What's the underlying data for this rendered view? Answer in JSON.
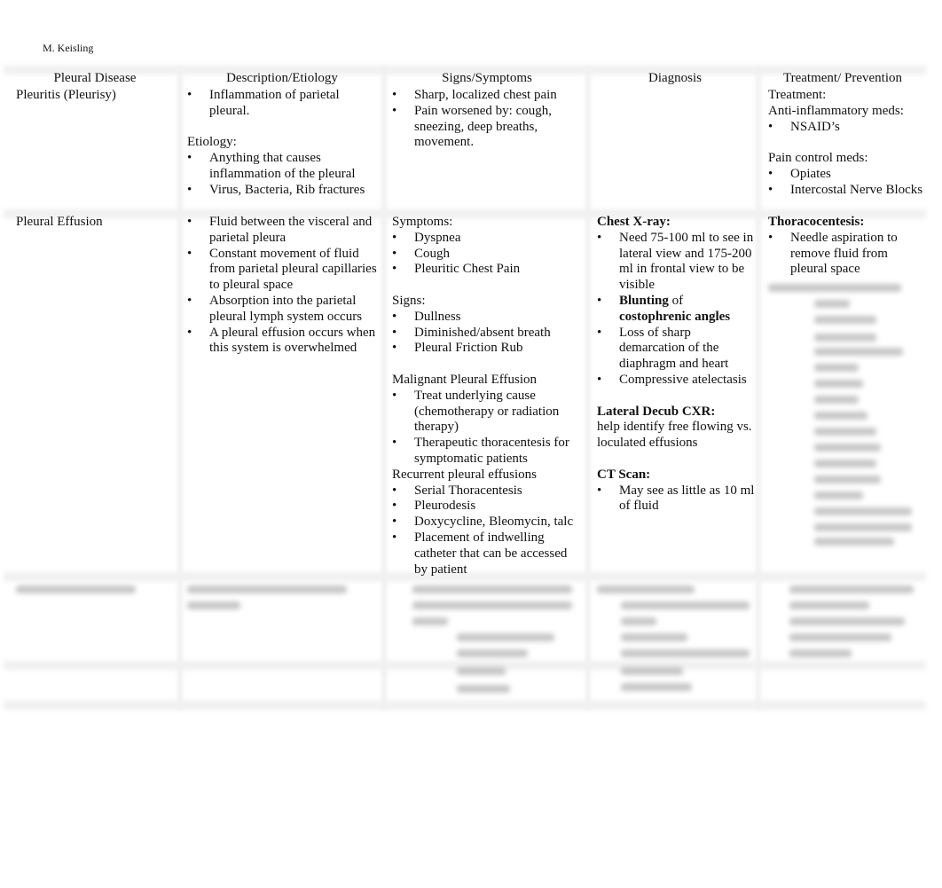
{
  "author": "M. Keisling",
  "headers": [
    "Pleural Disease",
    "Description/Etiology",
    "Signs/Symptoms",
    "Diagnosis",
    "Treatment/ Prevention"
  ],
  "rows": [
    {
      "cells": [
        [
          {
            "t": "p",
            "text": "Pleuritis (Pleurisy)"
          }
        ],
        [
          {
            "t": "li",
            "text": "Inflammation of parietal pleural."
          },
          {
            "t": "gap"
          },
          {
            "t": "p",
            "text": "Etiology:"
          },
          {
            "t": "li",
            "text": "Anything that causes inflammation of the pleural"
          },
          {
            "t": "li",
            "text": "Virus, Bacteria, Rib fractures"
          }
        ],
        [
          {
            "t": "li",
            "text": "Sharp, localized chest pain"
          },
          {
            "t": "li",
            "text": "Pain worsened by: cough, sneezing, deep breaths, movement."
          }
        ],
        [],
        [
          {
            "t": "p",
            "text": "Treatment:"
          },
          {
            "t": "p",
            "text": "Anti-inflammatory meds:"
          },
          {
            "t": "li",
            "text": "NSAID’s"
          },
          {
            "t": "gap"
          },
          {
            "t": "p",
            "text": "Pain control meds:"
          },
          {
            "t": "li",
            "text": "Opiates"
          },
          {
            "t": "li",
            "text": "Intercostal Nerve Blocks"
          }
        ]
      ]
    },
    {
      "cells": [
        [
          {
            "t": "p",
            "text": "Pleural Effusion"
          }
        ],
        [
          {
            "t": "li",
            "text": "Fluid between the visceral and parietal pleura"
          },
          {
            "t": "li",
            "text": "Constant movement of fluid from parietal pleural capillaries to pleural space"
          },
          {
            "t": "li",
            "text": "Absorption into the parietal pleural lymph system occurs"
          },
          {
            "t": "li",
            "text": "A pleural effusion occurs when this system is overwhelmed"
          }
        ],
        [
          {
            "t": "p",
            "text": "Symptoms:"
          },
          {
            "t": "li",
            "text": "Dyspnea"
          },
          {
            "t": "li",
            "text": "Cough"
          },
          {
            "t": "li",
            "text": "Pleuritic Chest Pain"
          },
          {
            "t": "gap"
          },
          {
            "t": "p",
            "text": "Signs:"
          },
          {
            "t": "li",
            "text": "Dullness"
          },
          {
            "t": "li",
            "text": "Diminished/absent breath"
          },
          {
            "t": "li",
            "text": "Pleural Friction Rub"
          },
          {
            "t": "gap"
          },
          {
            "t": "p",
            "text": "Malignant Pleural Effusion"
          },
          {
            "t": "li",
            "text": "Treat underlying cause (chemotherapy or radiation therapy)"
          },
          {
            "t": "li",
            "text": "Therapeutic thoracentesis for symptomatic patients"
          },
          {
            "t": "p",
            "text": "Recurrent pleural effusions"
          },
          {
            "t": "li",
            "text": "Serial Thoracentesis"
          },
          {
            "t": "li",
            "text": "Pleurodesis"
          },
          {
            "t": "li",
            "text": "Doxycycline, Bleomycin, talc"
          },
          {
            "t": "li",
            "text": "Placement of indwelling catheter that can be accessed by patient"
          }
        ],
        [
          {
            "t": "p",
            "bold": true,
            "text": "Chest X-ray:"
          },
          {
            "t": "li",
            "text": "Need 75-100 ml to see in lateral view and 175-200 ml in frontal view to be visible"
          },
          {
            "t": "li",
            "segs": [
              {
                "text": "Blunting",
                "bold": true
              },
              {
                "text": " of "
              },
              {
                "text": "costophrenic angles",
                "bold": true
              }
            ]
          },
          {
            "t": "li",
            "text": "Loss of sharp demarcation of the diaphragm and heart"
          },
          {
            "t": "li",
            "text": "Compressive atelectasis"
          },
          {
            "t": "gap"
          },
          {
            "t": "p",
            "bold": true,
            "text": "Lateral Decub CXR:"
          },
          {
            "t": "p",
            "text": "help identify free flowing vs. loculated effusions"
          },
          {
            "t": "gap"
          },
          {
            "t": "p",
            "bold": true,
            "text": "CT Scan:"
          },
          {
            "t": "li",
            "text": "May see as little as 10 ml of fluid"
          }
        ],
        [
          {
            "t": "p",
            "bold": true,
            "text": "Thoracocentesis:"
          },
          {
            "t": "li",
            "text": "Needle aspiration to remove fluid from pleural space"
          }
        ]
      ]
    }
  ]
}
